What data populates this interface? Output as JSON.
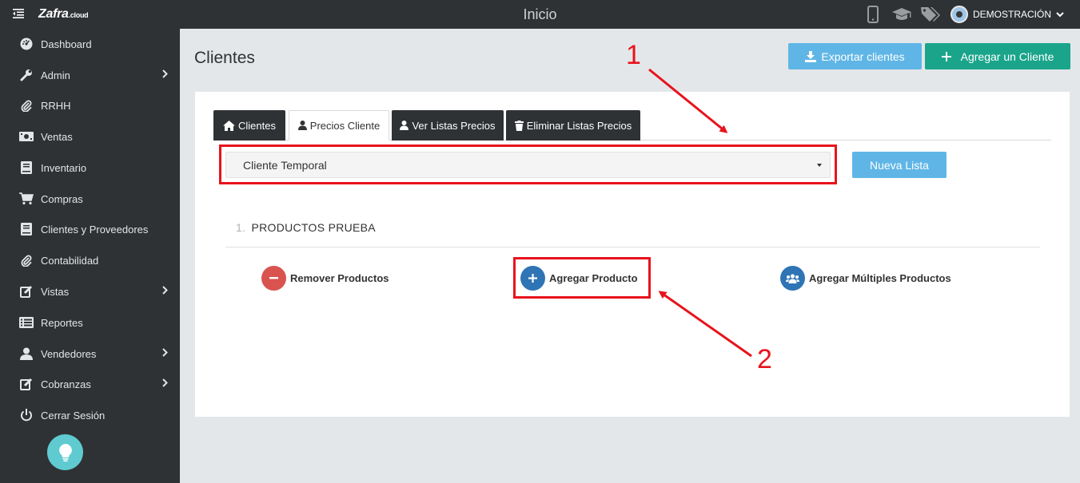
{
  "topbar": {
    "logo_text": "Zafra",
    "logo_suffix": ".cloud",
    "page_heading": "Inicio",
    "user_name": "DEMOSTRACIÓN",
    "icons": [
      "mobile-icon",
      "graduation-cap-icon",
      "tags-icon"
    ]
  },
  "sidebar": {
    "items": [
      {
        "label": "Dashboard",
        "icon": "dashboard-icon",
        "has_submenu": false
      },
      {
        "label": "Admin",
        "icon": "wrench-icon",
        "has_submenu": true
      },
      {
        "label": "RRHH",
        "icon": "paperclip-icon",
        "has_submenu": false
      },
      {
        "label": "Ventas",
        "icon": "money-icon",
        "has_submenu": false
      },
      {
        "label": "Inventario",
        "icon": "book-icon",
        "has_submenu": false
      },
      {
        "label": "Compras",
        "icon": "cart-icon",
        "has_submenu": false
      },
      {
        "label": "Clientes y Proveedores",
        "icon": "book-icon",
        "has_submenu": false
      },
      {
        "label": "Contabilidad",
        "icon": "paperclip-icon",
        "has_submenu": false
      },
      {
        "label": "Vistas",
        "icon": "edit-icon",
        "has_submenu": true
      },
      {
        "label": "Reportes",
        "icon": "list-icon",
        "has_submenu": false
      },
      {
        "label": "Vendedores",
        "icon": "user-icon",
        "has_submenu": true
      },
      {
        "label": "Cobranzas",
        "icon": "edit-icon",
        "has_submenu": true
      },
      {
        "label": "Cerrar Sesión",
        "icon": "power-icon",
        "has_submenu": false
      }
    ]
  },
  "main": {
    "title": "Clientes",
    "export_label": "Exportar clientes",
    "add_label": "Agregar un Cliente",
    "tabs": [
      {
        "label": "Clientes",
        "icon": "home-icon",
        "active": false
      },
      {
        "label": "Precios Cliente",
        "icon": "user-icon",
        "active": true
      },
      {
        "label": "Ver Listas Precios",
        "icon": "user-icon",
        "active": false
      },
      {
        "label": "Eliminar Listas Precios",
        "icon": "trash-icon",
        "active": false
      }
    ],
    "client_select": {
      "selected": "Cliente Temporal"
    },
    "new_list_label": "Nueva Lista",
    "section": {
      "number": "1.",
      "title": "PRODUCTOS PRUEBA"
    },
    "actions": [
      {
        "label": "Remover Productos",
        "icon": "minus-icon"
      },
      {
        "label": "Agregar Producto",
        "icon": "plus-icon"
      },
      {
        "label": "Agregar Múltiples Productos",
        "icon": "users-icon"
      }
    ]
  },
  "annotations": {
    "marker_1": "1",
    "marker_2": "2",
    "color": "#e8131c"
  },
  "colors": {
    "dark": "#2f3235",
    "light_blue": "#5fb6e6",
    "green": "#1aa58b",
    "red": "#d9534f",
    "blue": "#2f74b5",
    "teal": "#5fcbd1"
  }
}
